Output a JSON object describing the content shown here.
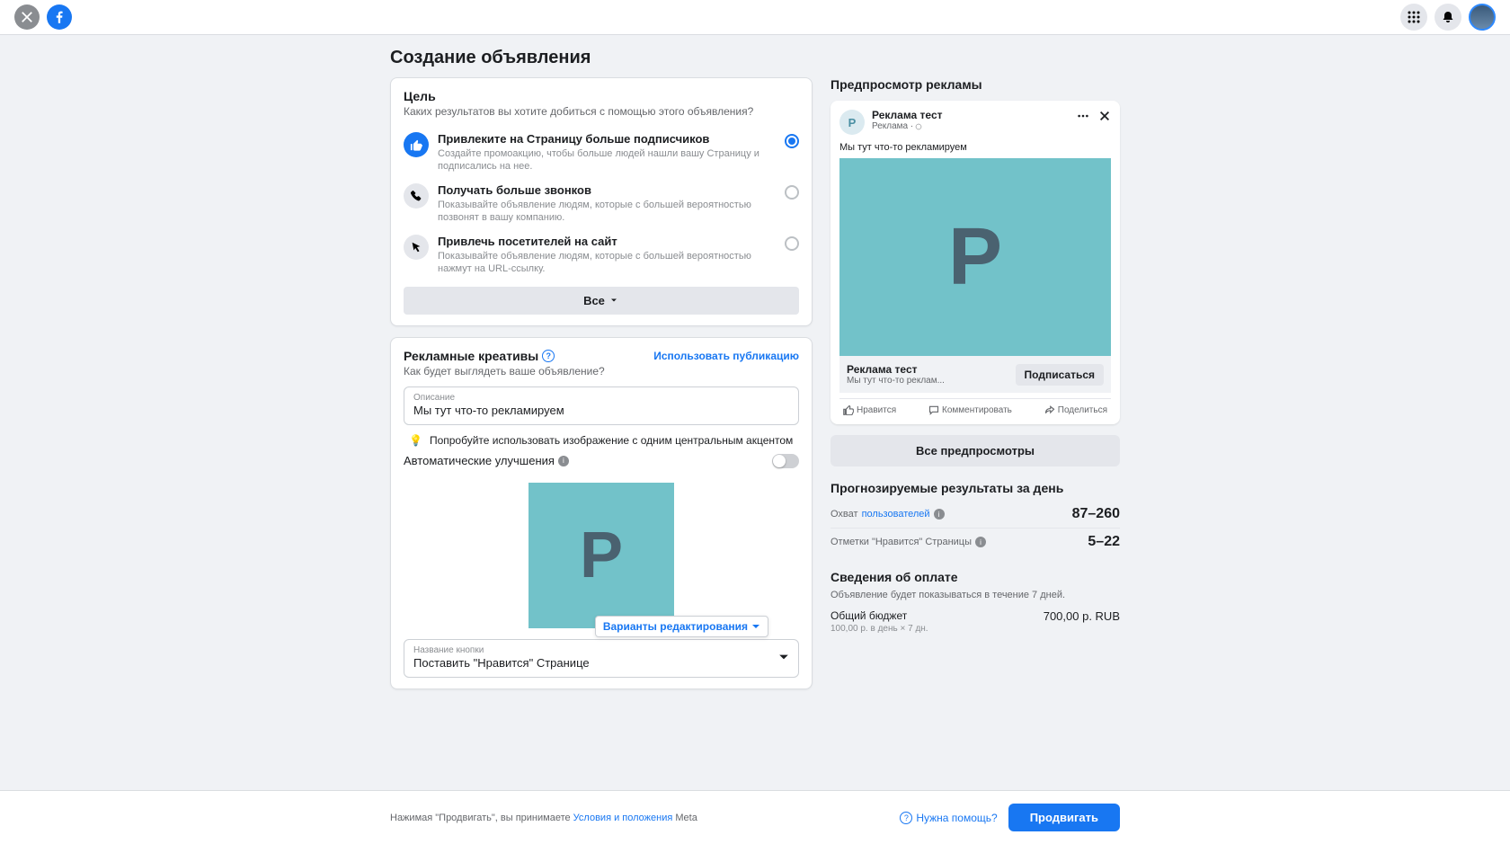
{
  "page_title": "Создание объявления",
  "goal_card": {
    "title": "Цель",
    "subtitle": "Каких результатов вы хотите добиться с помощью этого объявления?",
    "options": [
      {
        "label": "Привлеките на Страницу больше подписчиков",
        "desc": "Создайте промоакцию, чтобы больше людей нашли вашу Страницу и подписались на нее.",
        "selected": true
      },
      {
        "label": "Получать больше звонков",
        "desc": "Показывайте объявление людям, которые с большей вероятностью позвонят в вашу компанию.",
        "selected": false
      },
      {
        "label": "Привлечь посетителей на сайт",
        "desc": "Показывайте объявление людям, которые с большей вероятностью нажмут на URL-ссылку.",
        "selected": false
      }
    ],
    "all": "Все"
  },
  "creative_card": {
    "title": "Рекламные креативы",
    "use_pub": "Использовать публикацию",
    "subtitle": "Как будет выглядеть ваше объявление?",
    "desc_label": "Описание",
    "desc_value": "Мы тут что-то рекламируем",
    "tip": "Попробуйте использовать изображение с одним центральным акцентом",
    "auto_label": "Автоматические улучшения",
    "edit_variants": "Варианты редактирования",
    "btn_label_label": "Название кнопки",
    "btn_label_value": "Поставить \"Нравится\" Странице",
    "p_letter": "Р"
  },
  "preview": {
    "title": "Предпросмотр рекламы",
    "page_name": "Реклама тест",
    "sub": "Реклама ·",
    "body": "Мы тут что-то рекламируем",
    "bar_title": "Реклама тест",
    "bar_sub": "Мы тут что-то реклам...",
    "subscribe": "Подписаться",
    "like": "Нравится",
    "comment": "Комментировать",
    "share": "Поделиться",
    "all_prev": "Все предпросмотры",
    "p_letter": "Р"
  },
  "forecast": {
    "title": "Прогнозируемые результаты за день",
    "reach_label": "Охват",
    "reach_link": "пользователей",
    "reach_value": "87–260",
    "likes_label": "Отметки \"Нравится\" Страницы",
    "likes_value": "5–22"
  },
  "payment": {
    "title": "Сведения об оплате",
    "sub": "Объявление будет показываться в течение 7 дней.",
    "budget_label": "Общий бюджет",
    "budget_sub": "100,00 р. в день × 7 дн.",
    "budget_value": "700,00 р. RUB"
  },
  "footer": {
    "pre": "Нажимая \"Продвигать\", вы принимаете ",
    "terms": "Условия и положения",
    "post": " Meta",
    "help": "Нужна помощь?",
    "promote": "Продвигать"
  }
}
